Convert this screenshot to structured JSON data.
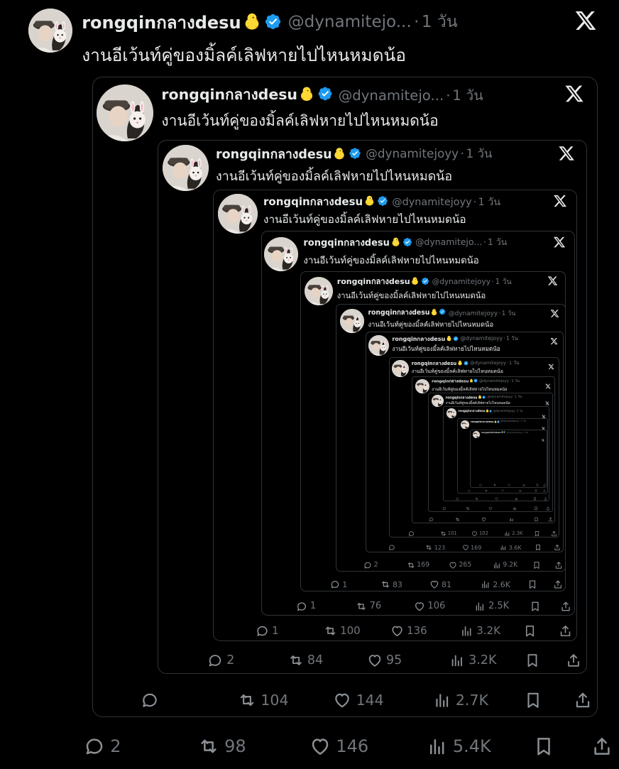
{
  "tweet": {
    "display_name": "rongqinกลางdesu",
    "name_emoji": "🐥",
    "handle": "@dynamitejo...",
    "dot": "·",
    "time": "1 วัน",
    "text": "งานอีเว้นท์คู่ของมิ้ลค์เลิฟหายไปไหนหมดน้อ",
    "stats": {
      "reply": "2",
      "retweet": "98",
      "like": "146",
      "views": "5.4K"
    }
  },
  "quotes": [
    {
      "display_name": "rongqinกลางdesu",
      "handle": "@dynamitejo...",
      "time": "1 วัน",
      "text": "งานอีเว้นท์คู่ของมิ้ลค์เลิฟหายไปไหนหมดน้อ",
      "stats": {
        "reply": "",
        "retweet": "104",
        "like": "144",
        "views": "2.7K"
      }
    },
    {
      "display_name": "rongqinกลางdesu",
      "handle": "@dynamitejoyy",
      "time": "1 วัน",
      "text": "งานอีเว้นท์คู่ของมิ้ลค์เลิฟหายไปไหนหมดน้อ",
      "stats": {
        "reply": "2",
        "retweet": "84",
        "like": "95",
        "views": "3.2K"
      }
    },
    {
      "display_name": "rongqinกลางdesu",
      "handle": "@dynamitejoyy",
      "time": "1 วัน",
      "text": "งานอีเว้นท์คู่ของมิ้ลค์เลิฟหายไปไหนหมดน้อ",
      "stats": {
        "reply": "1",
        "retweet": "100",
        "like": "136",
        "views": "3.2K"
      }
    },
    {
      "display_name": "rongqinกลางdesu",
      "handle": "@dynamitejo...",
      "time": "1 วัน",
      "text": "งานอีเว้นท์คู่ของมิ้ลค์เลิฟหายไปไหนหมดน้อ",
      "stats": {
        "reply": "1",
        "retweet": "76",
        "like": "106",
        "views": "2.5K"
      }
    },
    {
      "display_name": "rongqinกลางdesu",
      "handle": "@dynamitejoyy",
      "time": "1 วัน",
      "text": "งานอีเว้นท์คู่ของมิ้ลค์เลิฟหายไปไหนหมดน้อ",
      "stats": {
        "reply": "1",
        "retweet": "83",
        "like": "81",
        "views": "2.6K"
      }
    },
    {
      "display_name": "rongqinกลางdesu",
      "handle": "@dynamitejoyy",
      "time": "1 วัน",
      "text": "งานอีเว้นท์คู่ของมิ้ลค์เลิฟหายไปไหนหมดน้อ",
      "stats": {
        "reply": "2",
        "retweet": "169",
        "like": "265",
        "views": "9.2K"
      }
    },
    {
      "display_name": "rongqinกลางdesu",
      "handle": "@dynamitejoyy",
      "time": "1 วัน",
      "text": "งานอีเว้นท์คู่ของมิ้ลค์เลิฟหายไปไหนหมดน้อ",
      "stats": {
        "reply": "",
        "retweet": "123",
        "like": "169",
        "views": "3.6K"
      }
    },
    {
      "display_name": "rongqinกลางdesu",
      "handle": "@dynamitejoyy",
      "time": "1 วัน",
      "text": "งานอีเว้นท์คู่ของมิ้ลค์เลิฟหายไปไหนหมดน้อ",
      "stats": {
        "reply": "",
        "retweet": "101",
        "like": "102",
        "views": "2.3K"
      }
    },
    {
      "display_name": "rongqinกลางdesu",
      "handle": "@dynamitejoyy",
      "time": "1 วัน",
      "text": "งานอีเว้นท์คู่ของมิ้ลค์เลิฟหายไปไหนหมดน้อ",
      "stats": {
        "reply": "",
        "retweet": "",
        "like": "",
        "views": ""
      }
    },
    {
      "display_name": "rongqinกลางdesu",
      "handle": "@dynamitejoyy",
      "time": "1 วัน",
      "text": "งานอีเว้นท์คู่ของมิ้ลค์เลิฟหายไปไหนหมดน้อ",
      "stats": {
        "reply": "",
        "retweet": "",
        "like": "",
        "views": ""
      }
    },
    {
      "display_name": "rongqinกลางdesu",
      "handle": "@dynamitejoyy",
      "time": "1 วัน",
      "text": "",
      "stats": {
        "reply": "",
        "retweet": "",
        "like": "",
        "views": ""
      }
    },
    {
      "display_name": "rongqinกลางdesu",
      "handle": "@dynamitejoyy",
      "time": "1 วัน",
      "text": "",
      "stats": {
        "reply": "",
        "retweet": "",
        "like": "",
        "views": ""
      }
    },
    {
      "display_name": "rongqinกลางdesu",
      "handle": "@dynamitejoyy",
      "time": "1 วัน",
      "text": "",
      "stats": {
        "reply": "",
        "retweet": "",
        "like": "",
        "views": ""
      }
    }
  ],
  "colors": {
    "background": "#000000",
    "text": "#e7e9ea",
    "muted": "#71767b",
    "verified": "#1d9bf0",
    "border": "#2f3336"
  },
  "icons": {
    "verified": "verified-badge-icon",
    "x_logo": "x-logo-icon",
    "reply": "reply-icon",
    "retweet": "retweet-icon",
    "like": "like-icon",
    "views": "views-icon",
    "bookmark": "bookmark-icon",
    "share": "share-icon"
  }
}
